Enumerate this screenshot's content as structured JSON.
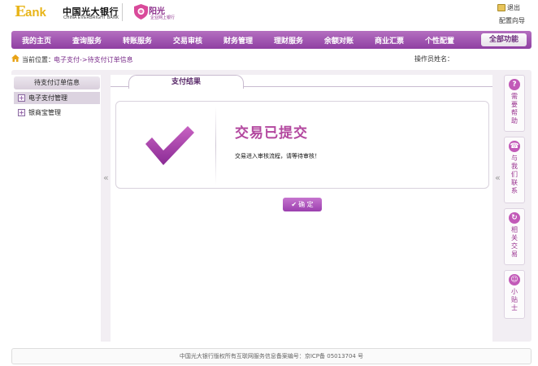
{
  "header": {
    "logo_e": "E",
    "logo_ank": "ank",
    "bank_name_cn": "中国光大银行",
    "bank_name_en": "CHINA EVERBRIGHT BANK",
    "sun_title": "阳光",
    "sun_sub": "企业网上银行",
    "exit_label": "退出",
    "guide_label": "配置向导"
  },
  "nav": {
    "items": [
      "我的主页",
      "查询服务",
      "转账服务",
      "交易审核",
      "财务管理",
      "理财服务",
      "余额对账",
      "商业汇票",
      "个性配置"
    ],
    "all_functions": "全部功能",
    "color": "#9b4aad"
  },
  "location": {
    "label": "当前位置：",
    "path": "电子支付->待支付订单信息",
    "operator_label": "操作员姓名："
  },
  "sidebar": {
    "title": "待支付订单信息",
    "items": [
      {
        "label": "电子支付管理",
        "active": true
      },
      {
        "label": "银商宝管理",
        "active": false
      }
    ]
  },
  "main": {
    "tab_label": "支付结果",
    "success_title": "交易已提交",
    "success_message": "交易进入审核流程，请等待审核！",
    "ok_label": "确 定"
  },
  "rightcol": {
    "items": [
      {
        "icon": "question-icon",
        "glyph": "?",
        "label": "需要帮助"
      },
      {
        "icon": "phone-icon",
        "glyph": "☎",
        "label": "与我们联系"
      },
      {
        "icon": "refresh-icon",
        "glyph": "↻",
        "label": "相关交易"
      },
      {
        "icon": "smile-icon",
        "glyph": "☺",
        "label": "小贴士"
      }
    ]
  },
  "collapse_glyph": "«",
  "footer": {
    "text": "中国光大银行版权所有互联网服务信息备案编号：京ICP备 05013704 号"
  }
}
